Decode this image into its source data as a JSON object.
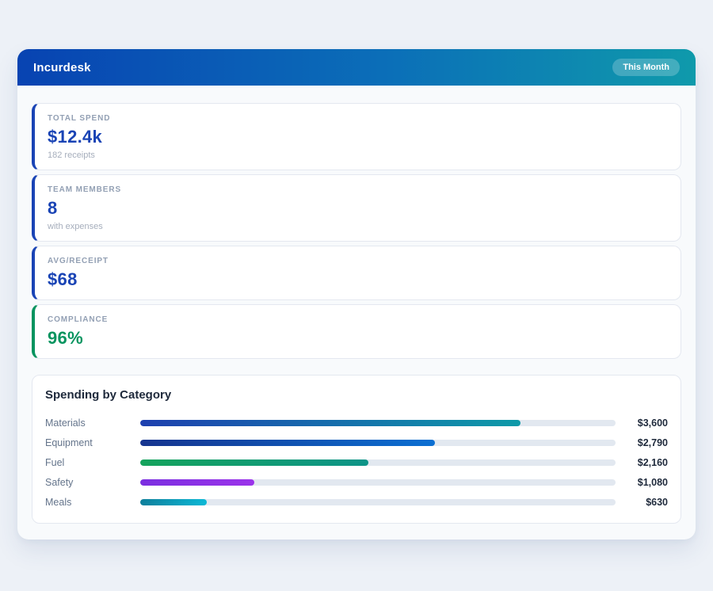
{
  "header": {
    "title": "Incurdesk",
    "period_badge": "This Month",
    "gradient_start": "#0843b2",
    "gradient_end": "#0f9aab"
  },
  "stats": [
    {
      "label": "TOTAL SPEND",
      "value": "$12.4k",
      "sub": "182 receipts",
      "accent": "#1a44b5"
    },
    {
      "label": "TEAM MEMBERS",
      "value": "8",
      "sub": "with expenses",
      "accent": "#1a44b5"
    },
    {
      "label": "AVG/RECEIPT",
      "value": "$68",
      "sub": "",
      "accent": "#1a44b5"
    },
    {
      "label": "COMPLIANCE",
      "value": "96%",
      "sub": "",
      "accent": "#07945f"
    }
  ],
  "chart_data": {
    "type": "bar",
    "orientation": "horizontal",
    "title": "Spending by Category",
    "categories": [
      "Materials",
      "Equipment",
      "Fuel",
      "Safety",
      "Meals"
    ],
    "values": [
      3600,
      2790,
      2160,
      1080,
      630
    ],
    "value_labels": [
      "$3,600",
      "$2,790",
      "$2,160",
      "$1,080",
      "$630"
    ],
    "xlim": [
      0,
      4500
    ],
    "grid": false,
    "legend": false,
    "track_color": "#e2e8f0",
    "bar_gradients": [
      [
        "#1e40af",
        "#0e9aa8"
      ],
      [
        "#16348f",
        "#0b6fd2"
      ],
      [
        "#15a35c",
        "#0d9488"
      ],
      [
        "#7b2fe0",
        "#9b33ea"
      ],
      [
        "#0e7f9b",
        "#0cb8d6"
      ]
    ]
  }
}
